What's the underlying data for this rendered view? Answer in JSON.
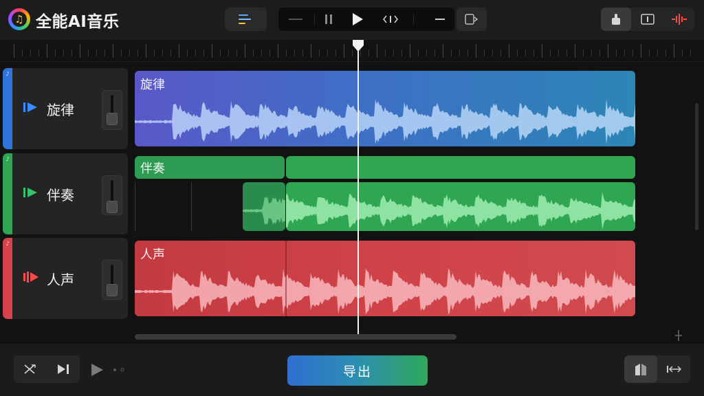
{
  "app": {
    "title": "全能AI音乐",
    "logo_glyph": "♫"
  },
  "toolbar": {
    "menu_icon": "menu-lines-icon",
    "transport": [
      "rewind-dash-icon",
      "pause-icon",
      "play-icon",
      "nudge-icon",
      "minus-icon"
    ],
    "devices_icon": "output-device-icon",
    "right_tools": [
      "hand-tool-icon",
      "split-tool-icon",
      "audio-spike-icon"
    ]
  },
  "tracks": [
    {
      "name": "旋律",
      "clip_label": "旋律",
      "color": "#3e6fc5",
      "icon": "play-triangle-icon"
    },
    {
      "name": "伴奏",
      "clip_label": "伴奏",
      "color": "#2ea652",
      "icon": "play-triangle-icon"
    },
    {
      "name": "人声",
      "clip_label": "人声",
      "color": "#cf4348",
      "icon": "speaker-icon"
    }
  ],
  "bottom": {
    "export_label": "导出",
    "left_tools": [
      "shuffle-icon",
      "skip-next-icon"
    ],
    "mini_play_icon": "play-icon",
    "right_tools": [
      "split-view-icon",
      "arrow-expand-icon"
    ]
  }
}
